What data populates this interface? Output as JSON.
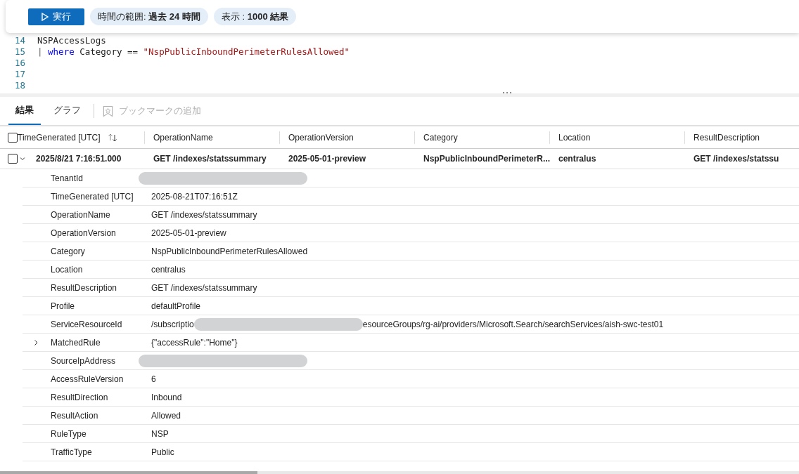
{
  "toolbar": {
    "run_button": {
      "label": "実行"
    },
    "time_range": {
      "label": "時間の範囲:",
      "value": "過去 24 時間"
    },
    "display": {
      "label": "表示 :",
      "value": "1000 結果"
    }
  },
  "editor": {
    "lines": [
      {
        "number": "14",
        "tokens": [
          {
            "kind": "ident",
            "text": "NSPAccessLogs"
          }
        ]
      },
      {
        "number": "15",
        "tokens": [
          {
            "kind": "pipe",
            "text": "|"
          },
          {
            "kind": "keyword",
            "text": "where"
          },
          {
            "kind": "ident",
            "text": "Category =="
          },
          {
            "kind": "string",
            "text": "\"NspPublicInboundPerimeterRulesAllowed\""
          }
        ]
      },
      {
        "number": "16"
      },
      {
        "number": "17"
      },
      {
        "number": "18"
      }
    ]
  },
  "result_tabs": [
    {
      "label": "結果",
      "selected": true
    },
    {
      "label": "グラフ",
      "selected": false
    }
  ],
  "bookmark_action": {
    "label": "ブックマークの追加",
    "disabled": true
  },
  "table": {
    "select_all_checked": false,
    "columns": [
      {
        "label": "TimeGenerated [UTC]",
        "sort_icon": true
      },
      {
        "label": "OperationName",
        "sort_icon": false
      },
      {
        "label": "OperationVersion",
        "sort_icon": false
      },
      {
        "label": "Category",
        "sort_icon": false
      },
      {
        "label": "Location",
        "sort_icon": false
      },
      {
        "label": "ResultDescription",
        "sort_icon": false
      }
    ],
    "rows": [
      {
        "checked": false,
        "expanded": true,
        "cells": [
          "2025/8/21 7:16:51.000",
          "GET /indexes/statssummary",
          "2025-05-01-preview",
          "NspPublicInboundPerimeterR...",
          "centralus",
          "GET /indexes/statssu"
        ],
        "details": [
          {
            "label": "TenantId",
            "redacted": true,
            "expandable": false
          },
          {
            "label": "TimeGenerated [UTC]",
            "value": "2025-08-21T07:16:51Z",
            "redacted": false,
            "expandable": false
          },
          {
            "label": "OperationName",
            "value": "GET /indexes/statssummary",
            "redacted": false,
            "expandable": false
          },
          {
            "label": "OperationVersion",
            "value": "2025-05-01-preview",
            "redacted": false,
            "expandable": false
          },
          {
            "label": "Category",
            "value": "NspPublicInboundPerimeterRulesAllowed",
            "redacted": false,
            "expandable": false
          },
          {
            "label": "Location",
            "value": "centralus",
            "redacted": false,
            "expandable": false
          },
          {
            "label": "ResultDescription",
            "value": "GET /indexes/statssummary",
            "redacted": false,
            "expandable": false
          },
          {
            "label": "Profile",
            "value": "defaultProfile",
            "redacted": false,
            "expandable": false
          },
          {
            "label": "ServiceResourceId",
            "value": "/subscriptio",
            "redacted": true,
            "value_after": "esourceGroups/rg-ai/providers/Microsoft.Search/searchServices/aish-swc-test01",
            "expandable": false
          },
          {
            "label": "MatchedRule",
            "value": "{\"accessRule\":\"Home\"}",
            "redacted": false,
            "expandable": true
          },
          {
            "label": "SourceIpAddress",
            "redacted": true,
            "expandable": false
          },
          {
            "label": "AccessRuleVersion",
            "value": "6",
            "redacted": false,
            "expandable": false
          },
          {
            "label": "ResultDirection",
            "value": "Inbound",
            "redacted": false,
            "expandable": false
          },
          {
            "label": "ResultAction",
            "value": "Allowed",
            "redacted": false,
            "expandable": false
          },
          {
            "label": "RuleType",
            "value": "NSP",
            "redacted": false,
            "expandable": false
          },
          {
            "label": "TrafficType",
            "value": "Public",
            "redacted": false,
            "expandable": false
          }
        ]
      }
    ]
  }
}
